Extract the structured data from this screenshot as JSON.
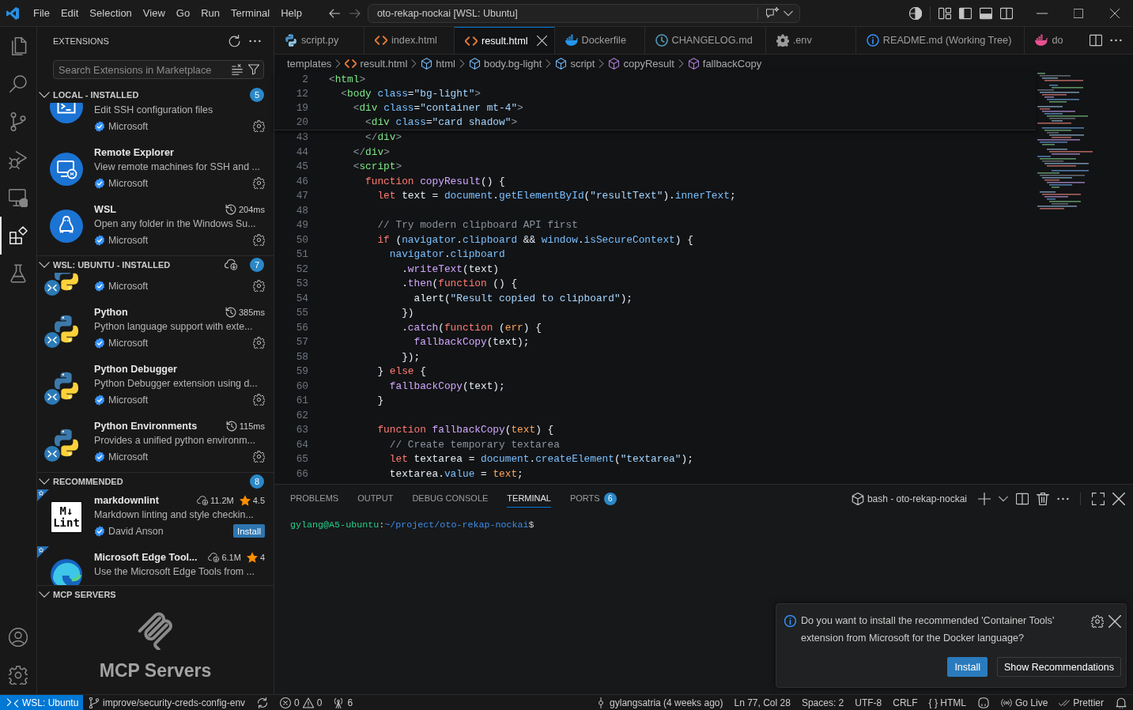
{
  "title_bar": {
    "menus": [
      "File",
      "Edit",
      "Selection",
      "View",
      "Go",
      "Run",
      "Terminal",
      "Help"
    ],
    "navigation": [
      {
        "kind": "back",
        "disabled": false
      },
      {
        "kind": "forward",
        "disabled": true
      }
    ],
    "command_center": "oto-rekap-nockai [WSL: Ubuntu]",
    "layout_toggles": [
      {
        "kind": "primary_sidebar",
        "on": true
      },
      {
        "kind": "panel",
        "on": true
      },
      {
        "kind": "secondary_sidebar",
        "on": false
      }
    ]
  },
  "activity_bar": {
    "items": [
      {
        "kind": "explorer",
        "selected": false
      },
      {
        "kind": "search",
        "selected": false
      },
      {
        "kind": "source_control",
        "selected": false
      },
      {
        "kind": "run_debug",
        "selected": false
      },
      {
        "kind": "remote_explorer",
        "selected": false
      },
      {
        "kind": "extensions",
        "selected": true
      },
      {
        "kind": "testing",
        "selected": false
      }
    ],
    "bottom": [
      {
        "kind": "accounts"
      },
      {
        "kind": "manage"
      }
    ]
  },
  "sidebar": {
    "title": "EXTENSIONS",
    "search": {
      "placeholder": "Search Extensions in Marketplace"
    },
    "sections": [
      {
        "kind": "list",
        "title": "LOCAL - INSTALLED",
        "expanded": true,
        "count": "5",
        "items": [
          {
            "kind": "terminal",
            "description": "Edit SSH configuration files",
            "publisher": "Microsoft",
            "verified": true,
            "installed": true
          },
          {
            "kind": "monitor",
            "title": "Remote Explorer",
            "description": "View remote machines for SSH and ...",
            "publisher": "Microsoft",
            "verified": true,
            "installed": true
          },
          {
            "kind": "penguin",
            "title": "WSL",
            "activation_time": "204ms",
            "description": "Open any folder in the Windows Su...",
            "publisher": "Microsoft",
            "verified": true,
            "installed": true
          }
        ]
      },
      {
        "kind": "remote_list",
        "title": "WSL: UBUNTU - INSTALLED",
        "expanded": true,
        "count": "7",
        "items": [
          {
            "kind": "python",
            "publisher": "Microsoft",
            "verified": true,
            "installed": true,
            "remote": true
          },
          {
            "kind": "python",
            "title": "Python",
            "activation_time": "385ms",
            "description": "Python language support with exte...",
            "publisher": "Microsoft",
            "verified": true,
            "installed": true,
            "remote": true
          },
          {
            "kind": "python",
            "title": "Python Debugger",
            "description": "Python Debugger extension using d...",
            "publisher": "Microsoft",
            "verified": true,
            "installed": true,
            "remote": true
          },
          {
            "kind": "python",
            "title": "Python Environments",
            "activation_time": "115ms",
            "description": "Provides a unified python environm...",
            "publisher": "Microsoft",
            "verified": true,
            "installed": true,
            "remote": true
          }
        ]
      },
      {
        "kind": "list",
        "title": "RECOMMENDED",
        "expanded": true,
        "count": "8",
        "items": [
          {
            "kind": "markdownlint",
            "logo_text": [
              "M↓",
              "Lint"
            ],
            "title": "markdownlint",
            "downloads": "11.2M",
            "rating": "4.5",
            "description": "Markdown linting and style checkin...",
            "publisher": "David Anson",
            "verified": true,
            "install_label": "Install",
            "recommended": true
          },
          {
            "kind": "edge",
            "title": "Microsoft Edge Tool...",
            "downloads": "6.1M",
            "rating": "4",
            "description": "Use the Microsoft Edge Tools from ...",
            "recommended": true
          }
        ]
      },
      {
        "kind": "welcome",
        "title": "MCP SERVERS",
        "expanded": true,
        "heading": "MCP Servers"
      }
    ]
  },
  "editor": {
    "tabs": [
      {
        "label": "script.py",
        "kind": "python",
        "selected": false
      },
      {
        "label": "index.html",
        "kind": "html",
        "selected": false
      },
      {
        "label": "result.html",
        "kind": "html",
        "selected": true
      },
      {
        "label": "Dockerfile",
        "kind": "docker",
        "selected": false
      },
      {
        "label": "CHANGELOG.md",
        "kind": "changelog",
        "selected": false
      },
      {
        "label": ".env",
        "kind": "env",
        "selected": false
      },
      {
        "label": "README.md (Working Tree)",
        "kind": "info",
        "selected": false
      },
      {
        "label": "do",
        "kind": "compose",
        "selected": false
      }
    ],
    "breadcrumbs": [
      {
        "label": "templates",
        "kind": "folder"
      },
      {
        "label": "result.html",
        "kind": "html"
      },
      {
        "label": "html",
        "kind": "element"
      },
      {
        "label": "body.bg-light",
        "kind": "element"
      },
      {
        "label": "script",
        "kind": "element"
      },
      {
        "label": "copyResult",
        "kind": "function"
      },
      {
        "label": "fallbackCopy",
        "kind": "function"
      }
    ],
    "sticky_lines": [
      {
        "number": "2",
        "tokens": [
          {
            "text": "<",
            "kind": "punct"
          },
          {
            "text": "html",
            "kind": "tag"
          },
          {
            "text": ">",
            "kind": "punct"
          }
        ]
      },
      {
        "number": "12",
        "tokens": [
          {
            "text": "  <",
            "kind": "punct"
          },
          {
            "text": "body",
            "kind": "tag"
          },
          {
            "text": " class",
            "kind": "attr"
          },
          {
            "text": "=",
            "kind": "text"
          },
          {
            "text": "\"bg-light\"",
            "kind": "string"
          },
          {
            "text": ">",
            "kind": "punct"
          }
        ]
      },
      {
        "number": "19",
        "tokens": [
          {
            "text": "    <",
            "kind": "punct"
          },
          {
            "text": "div",
            "kind": "tag"
          },
          {
            "text": " class",
            "kind": "attr"
          },
          {
            "text": "=",
            "kind": "text"
          },
          {
            "text": "\"container mt-4\"",
            "kind": "string"
          },
          {
            "text": ">",
            "kind": "punct"
          }
        ]
      },
      {
        "number": "20",
        "tokens": [
          {
            "text": "      <",
            "kind": "punct"
          },
          {
            "text": "div",
            "kind": "tag"
          },
          {
            "text": " class",
            "kind": "attr"
          },
          {
            "text": "=",
            "kind": "text"
          },
          {
            "text": "\"card shadow\"",
            "kind": "string"
          },
          {
            "text": ">",
            "kind": "punct"
          }
        ]
      }
    ],
    "lines": [
      {
        "number": "43",
        "tokens": [
          {
            "text": "      </",
            "kind": "punct"
          },
          {
            "text": "div",
            "kind": "tag"
          },
          {
            "text": ">",
            "kind": "punct"
          }
        ]
      },
      {
        "number": "44",
        "tokens": [
          {
            "text": "    </",
            "kind": "punct"
          },
          {
            "text": "div",
            "kind": "tag"
          },
          {
            "text": ">",
            "kind": "punct"
          }
        ]
      },
      {
        "number": "45",
        "tokens": [
          {
            "text": "    <",
            "kind": "punct"
          },
          {
            "text": "script",
            "kind": "tag"
          },
          {
            "text": ">",
            "kind": "punct"
          }
        ]
      },
      {
        "number": "46",
        "tokens": [
          {
            "text": "      function",
            "kind": "keyword"
          },
          {
            "text": " copyResult",
            "kind": "function"
          },
          {
            "text": "() {",
            "kind": "text"
          }
        ]
      },
      {
        "number": "47",
        "tokens": [
          {
            "text": "        let",
            "kind": "keyword"
          },
          {
            "text": " text = ",
            "kind": "text"
          },
          {
            "text": "document",
            "kind": "property"
          },
          {
            "text": ".",
            "kind": "text"
          },
          {
            "text": "getElementById",
            "kind": "property"
          },
          {
            "text": "(",
            "kind": "text"
          },
          {
            "text": "\"resultText\"",
            "kind": "string"
          },
          {
            "text": ").",
            "kind": "text"
          },
          {
            "text": "innerText",
            "kind": "property"
          },
          {
            "text": ";",
            "kind": "text"
          }
        ]
      },
      {
        "number": "48"
      },
      {
        "number": "49",
        "tokens": [
          {
            "text": "        // Try modern clipboard API first",
            "kind": "comment"
          }
        ]
      },
      {
        "number": "50",
        "tokens": [
          {
            "text": "        if",
            "kind": "keyword"
          },
          {
            "text": " (",
            "kind": "text"
          },
          {
            "text": "navigator",
            "kind": "property"
          },
          {
            "text": ".",
            "kind": "text"
          },
          {
            "text": "clipboard",
            "kind": "property"
          },
          {
            "text": " && ",
            "kind": "text"
          },
          {
            "text": "window",
            "kind": "property"
          },
          {
            "text": ".",
            "kind": "text"
          },
          {
            "text": "isSecureContext",
            "kind": "property"
          },
          {
            "text": ") {",
            "kind": "text"
          }
        ]
      },
      {
        "number": "51",
        "tokens": [
          {
            "text": "          navigator",
            "kind": "property"
          },
          {
            "text": ".",
            "kind": "text"
          },
          {
            "text": "clipboard",
            "kind": "property"
          }
        ]
      },
      {
        "number": "52",
        "tokens": [
          {
            "text": "            .",
            "kind": "text"
          },
          {
            "text": "writeText",
            "kind": "function"
          },
          {
            "text": "(text)",
            "kind": "text"
          }
        ]
      },
      {
        "number": "53",
        "tokens": [
          {
            "text": "            .",
            "kind": "text"
          },
          {
            "text": "then",
            "kind": "function"
          },
          {
            "text": "(",
            "kind": "text"
          },
          {
            "text": "function",
            "kind": "keyword"
          },
          {
            "text": " () {",
            "kind": "text"
          }
        ]
      },
      {
        "number": "54",
        "tokens": [
          {
            "text": "              alert(",
            "kind": "text"
          },
          {
            "text": "\"Result copied to clipboard\"",
            "kind": "string"
          },
          {
            "text": ");",
            "kind": "text"
          }
        ]
      },
      {
        "number": "55",
        "tokens": [
          {
            "text": "            })",
            "kind": "text"
          }
        ]
      },
      {
        "number": "56",
        "tokens": [
          {
            "text": "            .",
            "kind": "text"
          },
          {
            "text": "catch",
            "kind": "function"
          },
          {
            "text": "(",
            "kind": "text"
          },
          {
            "text": "function",
            "kind": "keyword"
          },
          {
            "text": " (",
            "kind": "text"
          },
          {
            "text": "err",
            "kind": "parameter"
          },
          {
            "text": ") {",
            "kind": "text"
          }
        ]
      },
      {
        "number": "57",
        "tokens": [
          {
            "text": "              fallbackCopy",
            "kind": "function"
          },
          {
            "text": "(text);",
            "kind": "text"
          }
        ]
      },
      {
        "number": "58",
        "tokens": [
          {
            "text": "            });",
            "kind": "text"
          }
        ]
      },
      {
        "number": "59",
        "tokens": [
          {
            "text": "        } ",
            "kind": "text"
          },
          {
            "text": "else",
            "kind": "keyword"
          },
          {
            "text": " {",
            "kind": "text"
          }
        ]
      },
      {
        "number": "60",
        "tokens": [
          {
            "text": "          fallbackCopy",
            "kind": "function"
          },
          {
            "text": "(text);",
            "kind": "text"
          }
        ]
      },
      {
        "number": "61",
        "tokens": [
          {
            "text": "        }",
            "kind": "text"
          }
        ]
      },
      {
        "number": "62"
      },
      {
        "number": "63",
        "tokens": [
          {
            "text": "        function",
            "kind": "keyword"
          },
          {
            "text": " fallbackCopy",
            "kind": "function"
          },
          {
            "text": "(",
            "kind": "text"
          },
          {
            "text": "text",
            "kind": "parameter"
          },
          {
            "text": ") {",
            "kind": "text"
          }
        ]
      },
      {
        "number": "64",
        "tokens": [
          {
            "text": "          // Create temporary textarea",
            "kind": "comment"
          }
        ]
      },
      {
        "number": "65",
        "tokens": [
          {
            "text": "          let",
            "kind": "keyword"
          },
          {
            "text": " textarea = ",
            "kind": "text"
          },
          {
            "text": "document",
            "kind": "property"
          },
          {
            "text": ".",
            "kind": "text"
          },
          {
            "text": "createElement",
            "kind": "property"
          },
          {
            "text": "(",
            "kind": "text"
          },
          {
            "text": "\"textarea\"",
            "kind": "string"
          },
          {
            "text": ");",
            "kind": "text"
          }
        ]
      },
      {
        "number": "66",
        "tokens": [
          {
            "text": "          textarea.",
            "kind": "text"
          },
          {
            "text": "value",
            "kind": "property"
          },
          {
            "text": " = ",
            "kind": "text"
          },
          {
            "text": "text",
            "kind": "parameter"
          },
          {
            "text": ";",
            "kind": "text"
          }
        ]
      }
    ]
  },
  "panel": {
    "tabs": [
      {
        "label": "PROBLEMS",
        "selected": false
      },
      {
        "label": "OUTPUT",
        "selected": false
      },
      {
        "label": "DEBUG CONSOLE",
        "selected": false
      },
      {
        "label": "TERMINAL",
        "selected": true
      },
      {
        "label": "PORTS",
        "selected": false,
        "badge": "6"
      }
    ],
    "terminal_title": "bash - oto-rekap-nockai",
    "prompt": [
      {
        "text": "gylang@A5-ubuntu",
        "kind": "user"
      },
      {
        "text": ":",
        "kind": "plain"
      },
      {
        "text": "~/project/oto-rekap-nockai",
        "kind": "path"
      },
      {
        "text": "$",
        "kind": "plain"
      }
    ]
  },
  "notification": {
    "message": "Do you want to install the recommended 'Container Tools' extension from Microsoft for the Docker language?",
    "buttons": [
      {
        "label": "Install",
        "primary": true
      },
      {
        "label": "Show Recommendations",
        "primary": false
      }
    ]
  },
  "status_bar": {
    "remote": "WSL: Ubuntu",
    "left": [
      {
        "kind": "branch",
        "text": "improve/security-creds-config-env"
      },
      {
        "kind": "sync"
      },
      {
        "kind": "problems",
        "errors": "0",
        "warnings": "0"
      },
      {
        "kind": "ports",
        "text": "6"
      }
    ],
    "right": [
      {
        "kind": "blame",
        "text": "gylangsatria (4 weeks ago)"
      },
      {
        "kind": "text",
        "text": "Ln 77, Col 28"
      },
      {
        "kind": "text",
        "text": "Spaces: 2"
      },
      {
        "kind": "text",
        "text": "UTF-8"
      },
      {
        "kind": "text",
        "text": "CRLF"
      },
      {
        "kind": "text",
        "text": "{ } HTML"
      },
      {
        "kind": "copilot"
      },
      {
        "kind": "live",
        "text": "Go Live"
      },
      {
        "kind": "prettier",
        "text": "Prettier"
      },
      {
        "kind": "notifications"
      }
    ]
  }
}
